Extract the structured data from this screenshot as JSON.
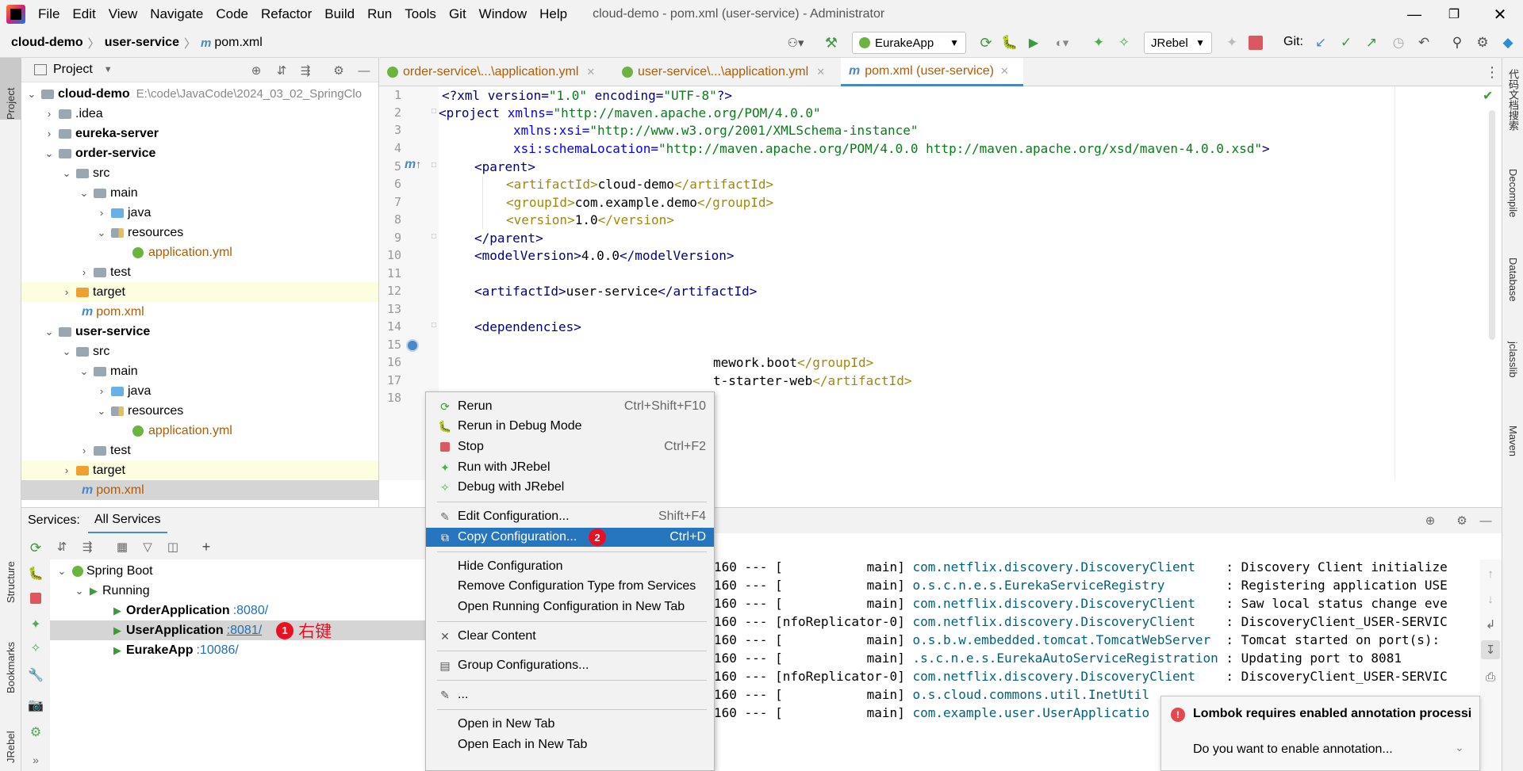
{
  "menubar": {
    "items": [
      "File",
      "Edit",
      "View",
      "Navigate",
      "Code",
      "Refactor",
      "Build",
      "Run",
      "Tools",
      "Git",
      "Window",
      "Help"
    ],
    "window_title": "cloud-demo - pom.xml (user-service) - Administrator"
  },
  "navbar": {
    "breadcrumb": [
      "cloud-demo",
      "user-service",
      "pom.xml"
    ],
    "run_config": "EurakeApp",
    "jrebel_config": "JRebel",
    "git_label": "Git:"
  },
  "project": {
    "title": "Project",
    "tree": [
      {
        "label": "cloud-demo",
        "extra": "E:\\code\\JavaCode\\2024_03_02_SpringClo",
        "bold": true
      },
      {
        "label": ".idea"
      },
      {
        "label": "eureka-server",
        "bold": true
      },
      {
        "label": "order-service",
        "bold": true
      },
      {
        "label": "src"
      },
      {
        "label": "main"
      },
      {
        "label": "java"
      },
      {
        "label": "resources"
      },
      {
        "label": "application.yml"
      },
      {
        "label": "test"
      },
      {
        "label": "target"
      },
      {
        "label": "pom.xml"
      },
      {
        "label": "user-service",
        "bold": true
      },
      {
        "label": "src"
      },
      {
        "label": "main"
      },
      {
        "label": "java"
      },
      {
        "label": "resources"
      },
      {
        "label": "application.yml"
      },
      {
        "label": "test"
      },
      {
        "label": "target"
      },
      {
        "label": "pom.xml"
      }
    ]
  },
  "editor": {
    "tabs": [
      "order-service\\...\\application.yml",
      "user-service\\...\\application.yml",
      "pom.xml (user-service)"
    ],
    "line_numbers": [
      "1",
      "2",
      "3",
      "4",
      "5",
      "6",
      "7",
      "8",
      "9",
      "10",
      "11",
      "12",
      "13",
      "14",
      "15",
      "16",
      "17",
      "18"
    ],
    "lines": {
      "l1a": "<?xml version=",
      "l1b": "\"1.0\"",
      "l1c": " encoding=",
      "l1d": "\"UTF-8\"",
      "l1e": "?>",
      "l2a": "<project ",
      "l2b": "xmlns=",
      "l2c": "\"http://maven.apache.org/POM/4.0.0\"",
      "l3a": "xmlns:xsi=",
      "l3b": "\"http://www.w3.org/2001/XMLSchema-instance\"",
      "l4a": "xsi:schemaLocation=",
      "l4b": "\"http://maven.apache.org/POM/4.0.0 http://maven.apache.org/xsd/maven-4.0.0.xsd\"",
      "l4c": ">",
      "l5": "<parent>",
      "l6a": "<artifactId>",
      "l6b": "cloud-demo",
      "l6c": "</artifactId>",
      "l7a": "<groupId>",
      "l7b": "com.example.demo",
      "l7c": "</groupId>",
      "l8a": "<version>",
      "l8b": "1.0",
      "l8c": "</version>",
      "l9": "</parent>",
      "l10a": "<modelVersion>",
      "l10b": "4.0.0",
      "l10c": "</modelVersion>",
      "l12a": "<artifactId>",
      "l12b": "user-service",
      "l12c": "</artifactId>",
      "l14": "<dependencies>",
      "l16a": "mework.boot",
      "l16b": "</groupId>",
      "l17a": "t-starter-web",
      "l17b": "</artifactId>"
    }
  },
  "services": {
    "label": "Services:",
    "tab": "All Services",
    "tree": [
      {
        "label": "Spring Boot"
      },
      {
        "label": "Running"
      },
      {
        "label": "OrderApplication",
        "port": ":8080/"
      },
      {
        "label": "UserApplication",
        "port": ":8081/"
      },
      {
        "label": "EurakeApp",
        "port": ":10086/"
      }
    ],
    "annotation_badge": "1",
    "annotation_text": "右键"
  },
  "console": {
    "lines": [
      {
        "pre": "160 --- [           main] ",
        "cls": "com.netflix.discovery.DiscoveryClient   ",
        "msg": " : Discovery Client initialize"
      },
      {
        "pre": "160 --- [           main] ",
        "cls": "o.s.c.n.e.s.EurekaServiceRegistry       ",
        "msg": " : Registering application USE"
      },
      {
        "pre": "160 --- [           main] ",
        "cls": "com.netflix.discovery.DiscoveryClient   ",
        "msg": " : Saw local status change eve"
      },
      {
        "pre": "160 --- [nfoReplicator-0] ",
        "cls": "com.netflix.discovery.DiscoveryClient   ",
        "msg": " : DiscoveryClient_USER-SERVIC"
      },
      {
        "pre": "160 --- [           main] ",
        "cls": "o.s.b.w.embedded.tomcat.TomcatWebServer ",
        "msg": " : Tomcat started on port(s): "
      },
      {
        "pre": "160 --- [           main] ",
        "cls": ".s.c.n.e.s.EurekaAutoServiceRegistration",
        "msg": " : Updating port to 8081"
      },
      {
        "pre": "160 --- [nfoReplicator-0] ",
        "cls": "com.netflix.discovery.DiscoveryClient   ",
        "msg": " : DiscoveryClient_USER-SERVIC"
      },
      {
        "pre": "160 --- [           main] ",
        "cls": "o.s.cloud.commons.util.InetUtil",
        "msg": ""
      },
      {
        "pre": "160 --- [           main] ",
        "cls": "com.example.user.UserApplicatio",
        "msg": ""
      }
    ]
  },
  "context_menu": {
    "items": [
      {
        "label": "Rerun",
        "shortcut": "Ctrl+Shift+F10"
      },
      {
        "label": "Rerun in Debug Mode",
        "shortcut": ""
      },
      {
        "label": "Stop",
        "shortcut": "Ctrl+F2"
      },
      {
        "label": "Run with JRebel",
        "shortcut": ""
      },
      {
        "label": "Debug with JRebel",
        "shortcut": ""
      },
      {
        "label": "Edit Configuration...",
        "shortcut": "Shift+F4"
      },
      {
        "label": "Copy Configuration...",
        "shortcut": "Ctrl+D"
      },
      {
        "label": "Hide Configuration",
        "shortcut": ""
      },
      {
        "label": "Remove Configuration Type from Services",
        "shortcut": ""
      },
      {
        "label": "Open Running Configuration in New Tab",
        "shortcut": ""
      },
      {
        "label": "Clear Content",
        "shortcut": ""
      },
      {
        "label": "Group Configurations...",
        "shortcut": ""
      },
      {
        "label": "...",
        "shortcut": ""
      },
      {
        "label": "Open in New Tab",
        "shortcut": ""
      },
      {
        "label": "Open Each in New Tab",
        "shortcut": ""
      }
    ],
    "copy_badge": "2"
  },
  "notification": {
    "title": "Lombok requires enabled annotation processi",
    "body": "Do you want to enable annotation..."
  },
  "sidebars": {
    "left": [
      "Project",
      "Structure",
      "Bookmarks",
      "JRebel"
    ],
    "right": [
      "代码文档搜索",
      "Decompile",
      "Database",
      "jclasslib",
      "Maven"
    ]
  },
  "colors": {
    "accent": "#2675bf",
    "badge": "#e81123",
    "annotation": "#e81123"
  }
}
